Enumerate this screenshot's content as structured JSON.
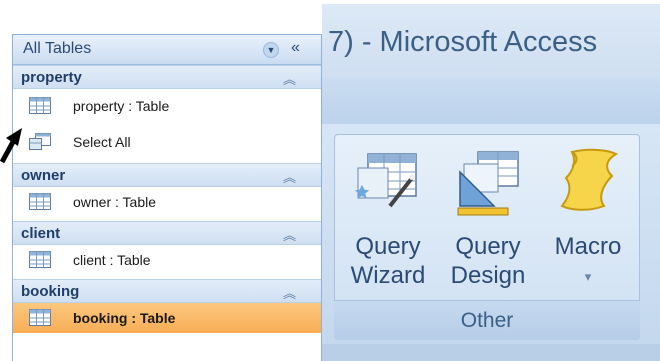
{
  "window": {
    "title": "7) - Microsoft Access"
  },
  "nav_pane": {
    "title": "All Tables",
    "dropdown_icon": "chevron-down-icon",
    "collapse_label": "«",
    "groups": [
      {
        "name": "property",
        "items": [
          {
            "label": "property : Table",
            "icon": "table-icon",
            "selected": false
          },
          {
            "label": "Select All",
            "icon": "query-icon",
            "selected": false
          }
        ]
      },
      {
        "name": "owner",
        "items": [
          {
            "label": "owner : Table",
            "icon": "table-icon",
            "selected": false
          }
        ]
      },
      {
        "name": "client",
        "items": [
          {
            "label": "client : Table",
            "icon": "table-icon",
            "selected": false
          }
        ]
      },
      {
        "name": "booking",
        "items": [
          {
            "label": "booking : Table",
            "icon": "table-icon",
            "selected": true
          }
        ]
      }
    ]
  },
  "ribbon": {
    "group_label": "Other",
    "buttons": [
      {
        "line1": "Query",
        "line2": "Wizard",
        "icon": "query-wizard-icon"
      },
      {
        "line1": "Query",
        "line2": "Design",
        "icon": "query-design-icon"
      },
      {
        "line1": "Macro",
        "line2": "▾",
        "icon": "macro-icon"
      }
    ]
  },
  "colors": {
    "selected": "#f8ad55",
    "title": "#3b5f86",
    "ribbon": "#cfe0f2"
  }
}
